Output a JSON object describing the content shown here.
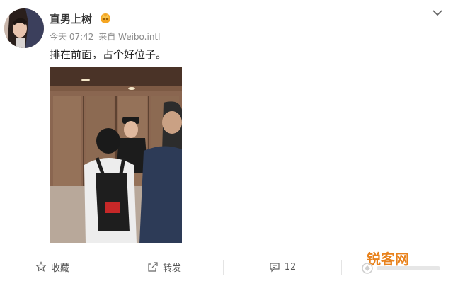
{
  "post": {
    "username": "直男上树",
    "time": "今天 07:42",
    "source": "来自 Weibo.intl",
    "text": "排在前面，占个好位子。"
  },
  "toolbar": {
    "favorite_label": "收藏",
    "repost_label": "转发",
    "comment_count": "12"
  },
  "watermark": {
    "logo_text": "锐客网"
  },
  "icons": {
    "badge": "crown-badge-icon",
    "expand": "chevron-down-icon",
    "favorite": "star-icon",
    "repost": "share-icon",
    "comment": "comment-icon"
  },
  "colors": {
    "username": "#333333",
    "meta": "#8a8a8a",
    "badge": "#f5a623",
    "watermark": "#e8821d"
  }
}
